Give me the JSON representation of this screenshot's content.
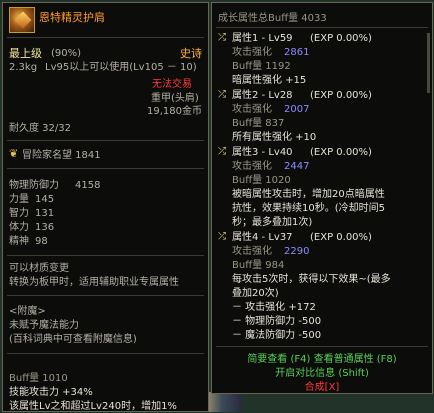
{
  "left": {
    "title": "恩特精灵护肩",
    "level_label": "最上级",
    "level_pct": "(90%)",
    "rarity": "史诗",
    "weight": "2.3kg",
    "level_req": "Lv95以上可以使用(Lv105 － 10)",
    "no_trade": "无法交易",
    "armor_type": "重甲(头肩)",
    "price": "19,180金币",
    "durability": "耐久度 32/32",
    "adventure": "冒险家名望 1841",
    "stats": [
      {
        "label": "物理防御力",
        "value": "4158"
      },
      {
        "label": "力量",
        "value": "145"
      },
      {
        "label": "智力",
        "value": "131"
      },
      {
        "label": "体力",
        "value": "136"
      },
      {
        "label": "精神",
        "value": "98"
      }
    ],
    "material_change": "可以材质变更",
    "convert_desc": "转换为板甲时，适用辅助职业专属属性",
    "enchant_label": "<附魔>",
    "enchant_none": "未赋予魔法能力",
    "enchant_hint": "(百科词典中可查看附魔信息)",
    "buff_amount": "Buff量 1010",
    "skill_atk": "技能攻击力 +34%",
    "truncated": "该属性Lv之和超过Lv240时，增加1%"
  },
  "right": {
    "header": "成长属性总Buff量 4033",
    "attrs": [
      {
        "name": "属性1 - Lv59",
        "exp": "(EXP 0.00%)",
        "atk_label": "攻击强化",
        "atk_value": "2861",
        "buff": "Buff量 1192",
        "effect": "暗属性强化 +15"
      },
      {
        "name": "属性2 - Lv28",
        "exp": "(EXP 0.00%)",
        "atk_label": "攻击强化",
        "atk_value": "2007",
        "buff": "Buff量 837",
        "effect": "所有属性强化 +10"
      },
      {
        "name": "属性3 - Lv40",
        "exp": "(EXP 0.00%)",
        "atk_label": "攻击强化",
        "atk_value": "2447",
        "buff": "Buff量 1020",
        "effect_lines": [
          "被暗属性攻击时，增加20点暗属性",
          "抗性，效果持续10秒。(冷却时间5",
          "秒；最多叠加1次)"
        ]
      },
      {
        "name": "属性4 - Lv37",
        "exp": "(EXP 0.00%)",
        "atk_label": "攻击强化",
        "atk_value": "2290",
        "buff": "Buff量 984",
        "effect_lines": [
          "每攻击5次时，获得以下效果~(最多",
          "叠加20次)",
          "－ 攻击强化 +172",
          "－ 物理防御力 -500",
          "－ 魔法防御力 -500"
        ]
      }
    ],
    "footer_line1": "简要查看 (F4) 查看普通属性 (F8)",
    "footer_line2": "开启对比信息 (Shift)",
    "footer_line3": "合成[X]"
  },
  "colors": {
    "rarity": "#ffb43c",
    "red_text": "#ff3a3a",
    "attack_value": "#8c8cff",
    "footer_green": "#5ad05a"
  }
}
